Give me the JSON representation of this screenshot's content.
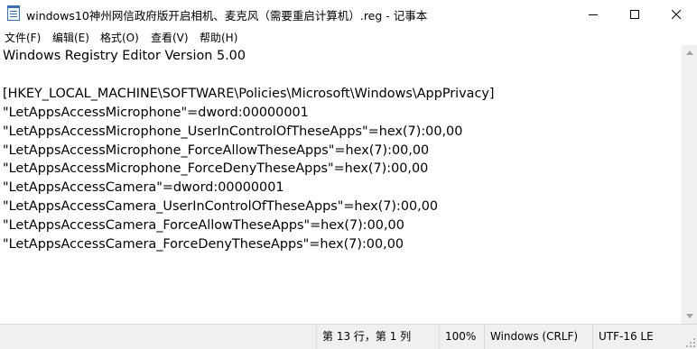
{
  "window": {
    "title": "windows10神州网信政府版开启相机、麦克风（需要重启计算机）.reg - 记事本",
    "app_icon": "notepad-icon",
    "controls": [
      "minimize-icon",
      "maximize-icon",
      "close-icon"
    ]
  },
  "menu": {
    "items": [
      "文件(F)",
      "编辑(E)",
      "格式(O)",
      "查看(V)",
      "帮助(H)"
    ]
  },
  "editor": {
    "lines": [
      "Windows Registry Editor Version 5.00",
      "",
      "[HKEY_LOCAL_MACHINE\\SOFTWARE\\Policies\\Microsoft\\Windows\\AppPrivacy]",
      "\"LetAppsAccessMicrophone\"=dword:00000001",
      "\"LetAppsAccessMicrophone_UserInControlOfTheseApps\"=hex(7):00,00",
      "\"LetAppsAccessMicrophone_ForceAllowTheseApps\"=hex(7):00,00",
      "\"LetAppsAccessMicrophone_ForceDenyTheseApps\"=hex(7):00,00",
      "\"LetAppsAccessCamera\"=dword:00000001",
      "\"LetAppsAccessCamera_UserInControlOfTheseApps\"=hex(7):00,00",
      "\"LetAppsAccessCamera_ForceAllowTheseApps\"=hex(7):00,00",
      "\"LetAppsAccessCamera_ForceDenyTheseApps\"=hex(7):00,00"
    ]
  },
  "status": {
    "position": "第 13 行，第 1 列",
    "zoom": "100%",
    "line_ending": "Windows (CRLF)",
    "encoding": "UTF-16 LE"
  }
}
